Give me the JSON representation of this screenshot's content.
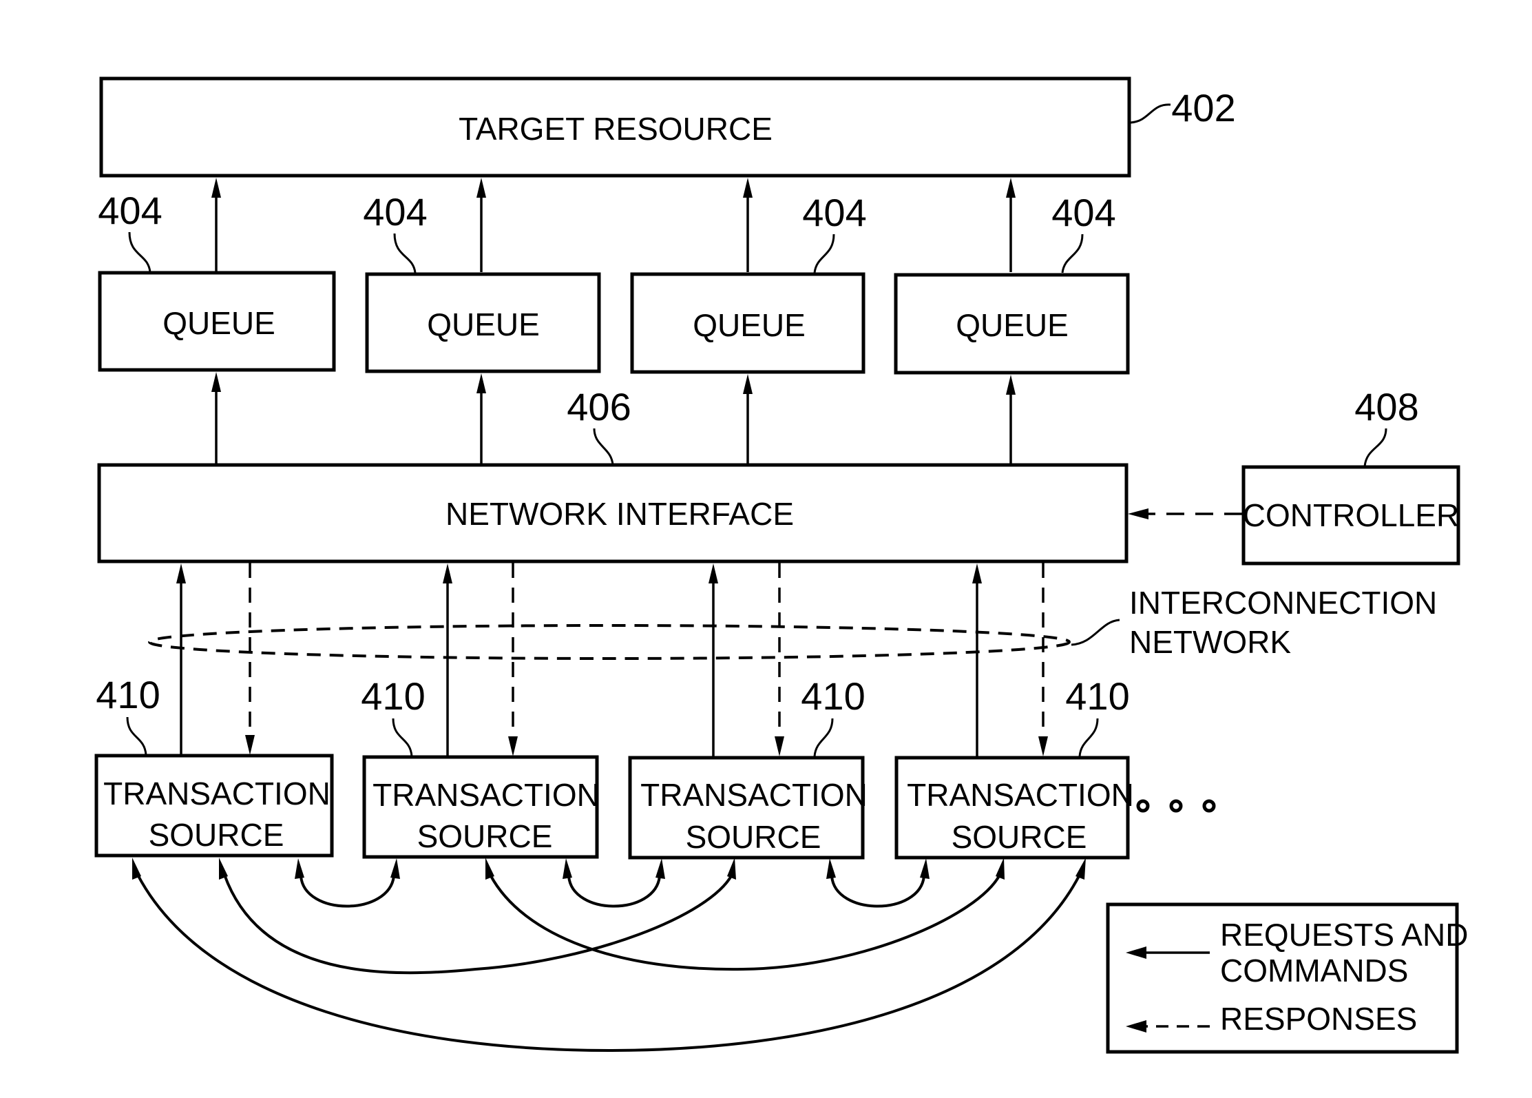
{
  "diagram": {
    "target_resource": {
      "label": "TARGET RESOURCE",
      "ref": "402"
    },
    "queues": [
      {
        "label": "QUEUE",
        "ref": "404"
      },
      {
        "label": "QUEUE",
        "ref": "404"
      },
      {
        "label": "QUEUE",
        "ref": "404"
      },
      {
        "label": "QUEUE",
        "ref": "404"
      }
    ],
    "network_interface": {
      "label": "NETWORK INTERFACE",
      "ref": "406"
    },
    "controller": {
      "label": "CONTROLLER",
      "ref": "408"
    },
    "interconnection_network": {
      "line1": "INTERCONNECTION",
      "line2": "NETWORK"
    },
    "transaction_sources": [
      {
        "line1": "TRANSACTION",
        "line2": "SOURCE",
        "ref": "410"
      },
      {
        "line1": "TRANSACTION",
        "line2": "SOURCE",
        "ref": "410"
      },
      {
        "line1": "TRANSACTION",
        "line2": "SOURCE",
        "ref": "410"
      },
      {
        "line1": "TRANSACTION",
        "line2": "SOURCE",
        "ref": "410"
      }
    ],
    "continuation": "ellipsis-dots",
    "legend": {
      "solid": {
        "line1": "REQUESTS AND",
        "line2": "COMMANDS"
      },
      "dashed": {
        "label": "RESPONSES"
      }
    }
  }
}
